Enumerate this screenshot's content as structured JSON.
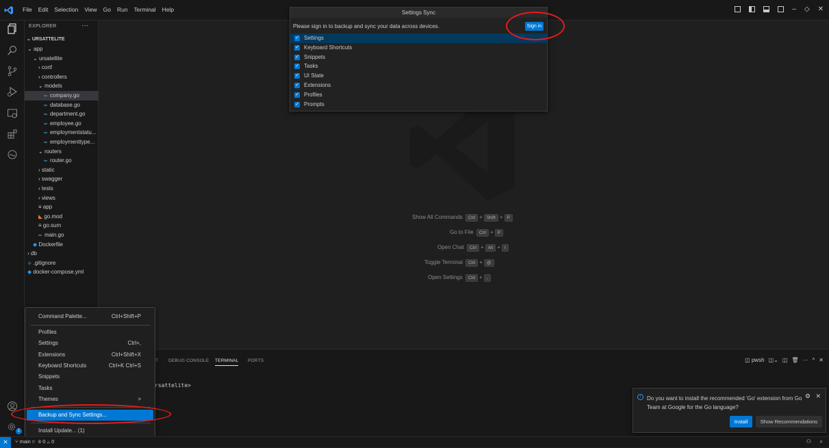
{
  "menubar": {
    "items": [
      "File",
      "Edit",
      "Selection",
      "View",
      "Go",
      "Run",
      "Terminal",
      "Help"
    ]
  },
  "explorer": {
    "header": "EXPLORER",
    "more": "···",
    "root": "URSATTELITE",
    "items": [
      {
        "label": "app",
        "type": "folder-open"
      },
      {
        "label": "ursatellite",
        "type": "folder-open"
      },
      {
        "label": "conf",
        "type": "folder"
      },
      {
        "label": "controllers",
        "type": "folder"
      },
      {
        "label": "models",
        "type": "folder-open"
      },
      {
        "label": "company.go",
        "type": "go"
      },
      {
        "label": "database.go",
        "type": "go"
      },
      {
        "label": "department.go",
        "type": "go"
      },
      {
        "label": "employee.go",
        "type": "go"
      },
      {
        "label": "employmentstatu...",
        "type": "go"
      },
      {
        "label": "employmenttype...",
        "type": "go"
      },
      {
        "label": "routers",
        "type": "folder-open"
      },
      {
        "label": "router.go",
        "type": "go"
      },
      {
        "label": "static",
        "type": "folder"
      },
      {
        "label": "swagger",
        "type": "folder"
      },
      {
        "label": "tests",
        "type": "folder"
      },
      {
        "label": "views",
        "type": "folder"
      },
      {
        "label": "app",
        "type": "file"
      },
      {
        "label": "go.mod",
        "type": "gomod"
      },
      {
        "label": "go.sum",
        "type": "file"
      },
      {
        "label": "main.go",
        "type": "go"
      },
      {
        "label": "Dockerfile",
        "type": "docker"
      },
      {
        "label": "db",
        "type": "folder"
      },
      {
        "label": ".gitignore",
        "type": "git"
      },
      {
        "label": "docker-compose.yml",
        "type": "docker"
      }
    ]
  },
  "settings_sync": {
    "title": "Settings Sync",
    "message": "Please sign in to backup and sync your data across devices.",
    "sign_in": "Sign in",
    "options": [
      "Settings",
      "Keyboard Shortcuts",
      "Snippets",
      "Tasks",
      "UI State",
      "Extensions",
      "Profiles",
      "Prompts"
    ]
  },
  "shortcuts": [
    {
      "label": "Show All Commands",
      "keys": [
        "Ctrl",
        "Shift",
        "P"
      ]
    },
    {
      "label": "Go to File",
      "keys": [
        "Ctrl",
        "P"
      ]
    },
    {
      "label": "Open Chat",
      "keys": [
        "Ctrl",
        "Alt",
        "I"
      ]
    },
    {
      "label": "Toggle Terminal",
      "keys": [
        "Ctrl",
        "@"
      ]
    },
    {
      "label": "Open Settings",
      "keys": [
        "Ctrl",
        ","
      ]
    }
  ],
  "panel": {
    "tabs": [
      "T",
      "DEBUG CONSOLE",
      "TERMINAL",
      "PORTS"
    ],
    "terminal_line": "rsattelite>",
    "shell": "pwsh"
  },
  "manage_menu": {
    "items": [
      {
        "label": "Command Palette...",
        "shortcut": "Ctrl+Shift+P"
      },
      {
        "label": "Profiles",
        "shortcut": ""
      },
      {
        "label": "Settings",
        "shortcut": "Ctrl+,"
      },
      {
        "label": "Extensions",
        "shortcut": "Ctrl+Shift+X"
      },
      {
        "label": "Keyboard Shortcuts",
        "shortcut": "Ctrl+K Ctrl+S"
      },
      {
        "label": "Snippets",
        "shortcut": ""
      },
      {
        "label": "Tasks",
        "shortcut": ""
      },
      {
        "label": "Themes",
        "shortcut": ">"
      },
      {
        "label": "Backup and Sync Settings...",
        "shortcut": ""
      },
      {
        "label": "Install Update... (1)",
        "shortcut": ""
      }
    ]
  },
  "notification": {
    "text": "Do you want to install the recommended 'Go' extension from Go Team at Google for the Go language?",
    "install": "Install",
    "show_recommendations": "Show Recommendations"
  },
  "status": {
    "branch": "main",
    "problems": "0",
    "warnings": "0",
    "update_badge": "1"
  },
  "colors": {
    "accent": "#0078d4",
    "annotation": "#e51c1c"
  }
}
